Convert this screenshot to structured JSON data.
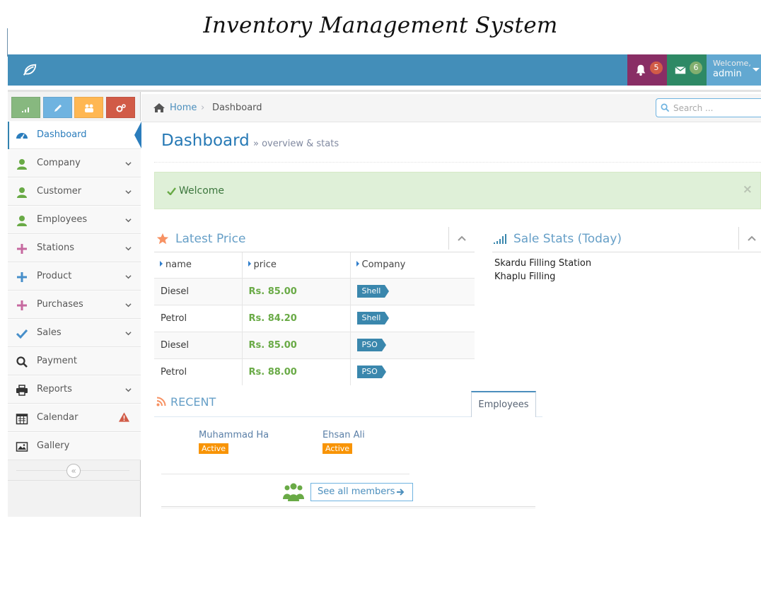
{
  "app_title": "Inventory Management System",
  "navbar": {
    "notifications": {
      "icon": "bell-icon",
      "count": "5"
    },
    "messages": {
      "icon": "envelope-icon",
      "count": "6"
    },
    "user": {
      "welcome": "Welcome,",
      "name": "admin"
    }
  },
  "shortcuts": [
    {
      "icon": "signal-icon",
      "color": "#87b87f"
    },
    {
      "icon": "pencil-icon",
      "color": "#6fb3e0"
    },
    {
      "icon": "users-icon",
      "color": "#ffb752"
    },
    {
      "icon": "cogs-icon",
      "color": "#d15b47"
    }
  ],
  "sidebar": {
    "items": [
      {
        "label": "Dashboard",
        "icon": "dashboard-icon",
        "active": true
      },
      {
        "label": "Company",
        "icon": "user-icon",
        "submenu": true
      },
      {
        "label": "Customer",
        "icon": "user-icon",
        "submenu": true
      },
      {
        "label": "Employees",
        "icon": "user-icon",
        "submenu": true
      },
      {
        "label": "Stations",
        "icon": "plus-icon",
        "submenu": true
      },
      {
        "label": "Product",
        "icon": "plus-icon",
        "submenu": true
      },
      {
        "label": "Purchases",
        "icon": "plus-icon",
        "submenu": true
      },
      {
        "label": "Sales",
        "icon": "check-icon",
        "submenu": true
      },
      {
        "label": "Payment",
        "icon": "search-icon",
        "submenu": false
      },
      {
        "label": "Reports",
        "icon": "print-icon",
        "submenu": true
      },
      {
        "label": "Calendar",
        "icon": "calendar-icon",
        "submenu": false,
        "warning": true
      },
      {
        "label": "Gallery",
        "icon": "picture-icon",
        "submenu": false
      }
    ]
  },
  "breadcrumb": {
    "home": "Home",
    "current": "Dashboard"
  },
  "search": {
    "placeholder": "Search ...",
    "value": ""
  },
  "page_header": {
    "title": "Dashboard",
    "subtitle": "» overview & stats"
  },
  "alert": {
    "message": "Welcome",
    "close": "×"
  },
  "latest_price": {
    "title": "Latest Price",
    "columns": [
      "name",
      "price",
      "Company"
    ],
    "rows": [
      {
        "name": "Diesel",
        "price": "Rs. 85.00",
        "company": "Shell"
      },
      {
        "name": "Petrol",
        "price": "Rs. 84.20",
        "company": "Shell"
      },
      {
        "name": "Diesel",
        "price": "Rs. 85.00",
        "company": "PSO"
      },
      {
        "name": "Petrol",
        "price": "Rs. 88.00",
        "company": "PSO"
      }
    ]
  },
  "sale_stats": {
    "title": "Sale Stats (Today)",
    "items": [
      "Skardu Filling Station",
      "Khaplu Filling"
    ]
  },
  "recent": {
    "title": "RECENT",
    "tab": "Employees",
    "members": [
      {
        "name": "Muhammad Ha",
        "status": "Active"
      },
      {
        "name": "Ehsan Ali",
        "status": "Active"
      }
    ],
    "see_all": "See all members"
  }
}
